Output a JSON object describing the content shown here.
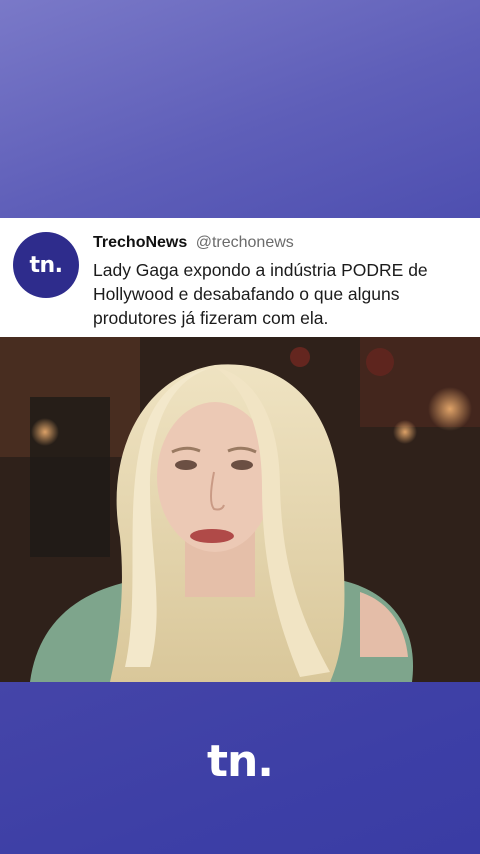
{
  "tweet": {
    "avatar_text": "tn.",
    "author_name": "TrechoNews",
    "author_handle": "@trechonews",
    "text": "Lady Gaga expondo a indústria PODRE de Hollywood e desabafando o que alguns produtores já fizeram com ela."
  },
  "footer": {
    "brand_logo_text": "tn."
  },
  "colors": {
    "brand_purple": "#2e2c8c",
    "background_gradient": "#5f5fb9",
    "footer_blue": "#3d3fa6"
  }
}
